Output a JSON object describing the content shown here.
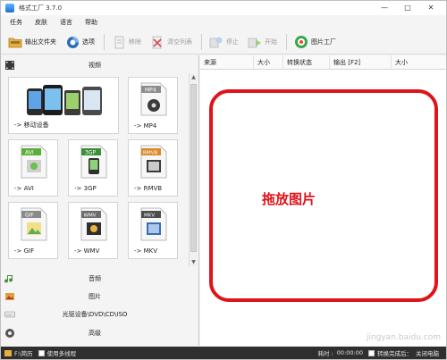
{
  "window": {
    "title": "格式工厂 3.7.0"
  },
  "menu": [
    "任务",
    "皮肤",
    "语言",
    "帮助"
  ],
  "toolbar": {
    "output_folder": "输出文件夹",
    "options": "选项",
    "remove": "移除",
    "clear_list": "清空列表",
    "stop": "停止",
    "start": "开始",
    "picture_factory": "图片工厂"
  },
  "categories": {
    "video": "视频",
    "audio": "音频",
    "picture": "图片",
    "disc": "光驱设备\\DVD\\CD\\ISO",
    "advanced": "高级"
  },
  "tiles": [
    {
      "label": "-> 移动设备",
      "icon": "mobile-devices-icon",
      "badge": ""
    },
    {
      "label": "-> MP4",
      "icon": "mp4-file-icon",
      "badge": "MP4"
    },
    {
      "label": "-> AVI",
      "icon": "avi-file-icon",
      "badge": "AVI"
    },
    {
      "label": "-> 3GP",
      "icon": "3gp-file-icon",
      "badge": "3GP"
    },
    {
      "label": "-> RMVB",
      "icon": "rmvb-file-icon",
      "badge": "RMVB"
    },
    {
      "label": "-> GIF",
      "icon": "gif-file-icon",
      "badge": "GIF"
    },
    {
      "label": "-> WMV",
      "icon": "wmv-file-icon",
      "badge": "WMV"
    },
    {
      "label": "-> MKV",
      "icon": "mkv-file-icon",
      "badge": "MKV"
    }
  ],
  "list_columns": [
    "来源",
    "大小",
    "转换状态",
    "输出 [F2]",
    "大小"
  ],
  "drop_hint": "拖放图片",
  "watermark": "jingyan.baidu.com",
  "statusbar": {
    "path": "F:\\简历",
    "multithread": "使用多线程",
    "time_label": "耗时 :",
    "time_value": "00:00:00",
    "after_convert": "转换完成后：",
    "shutdown": "关闭电脑"
  },
  "colors": {
    "accent_red": "#e0121a",
    "status_bar": "#2f2f2f"
  }
}
